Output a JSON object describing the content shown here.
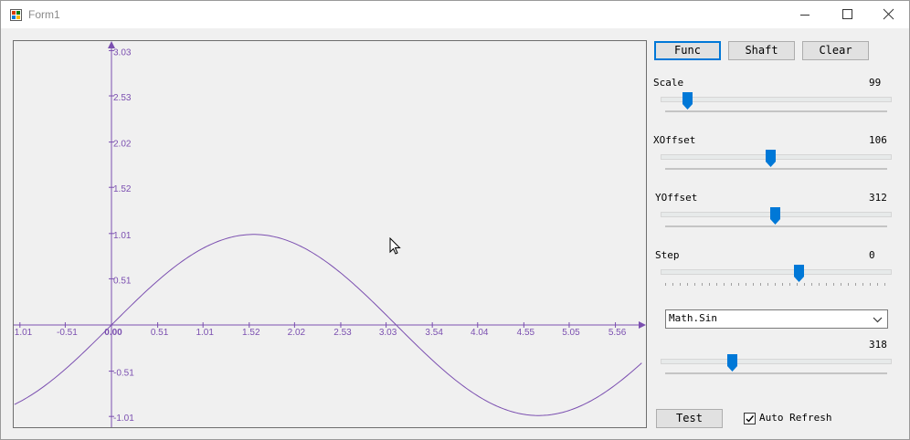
{
  "window": {
    "title": "Form1",
    "icon": "form-app-icon",
    "controls": [
      "minimize-icon",
      "maximize-icon",
      "close-icon"
    ]
  },
  "toolbar": {
    "func_label": "Func",
    "shaft_label": "Shaft",
    "clear_label": "Clear"
  },
  "sliders": {
    "scale": {
      "label": "Scale",
      "value": "99",
      "level": 0.1
    },
    "xoffset": {
      "label": "XOffset",
      "value": "106",
      "level": 0.49
    },
    "yoffset": {
      "label": "YOffset",
      "value": "312",
      "level": 0.51
    },
    "step": {
      "label": "Step",
      "value": "0",
      "level": 0.62
    },
    "function_param": {
      "value": "318",
      "level": 0.31
    }
  },
  "function_select": {
    "selected": "Math.Sin"
  },
  "bottom": {
    "test_label": "Test",
    "auto_refresh_label": "Auto Refresh",
    "auto_refresh_checked": true
  },
  "chart_data": {
    "type": "line",
    "function": "Math.Sin",
    "x_ticks": [
      "-1.01",
      "-0.51",
      "0.00",
      "0.51",
      "1.01",
      "1.52",
      "2.02",
      "2.53",
      "3.03",
      "3.54",
      "4.04",
      "4.55",
      "5.05",
      "5.56"
    ],
    "y_ticks": [
      "3.03",
      "2.53",
      "2.02",
      "1.52",
      "1.01",
      "0.51",
      "-0.51",
      "-1.01"
    ],
    "xlim": [
      -1.07,
      5.85
    ],
    "ylim": [
      -1.07,
      3.2
    ],
    "series": [
      {
        "x": [
          -1.07,
          -0.75,
          -0.5,
          -0.25,
          0,
          0.25,
          0.5,
          0.75,
          1.0,
          1.25,
          1.5707,
          1.75,
          2.0,
          2.25,
          2.5,
          2.75,
          3.0,
          3.1416,
          3.5,
          4.0,
          4.5,
          4.7124,
          5.0,
          5.5,
          5.85
        ],
        "y": [
          -0.877,
          -0.682,
          -0.479,
          -0.247,
          0.0,
          0.247,
          0.479,
          0.682,
          0.841,
          0.949,
          1.0,
          0.984,
          0.909,
          0.778,
          0.598,
          0.382,
          0.141,
          0.0,
          -0.351,
          -0.757,
          -0.978,
          -1.0,
          -0.959,
          -0.706,
          -0.417
        ]
      }
    ],
    "color": "#7b4fb0",
    "grid": false
  },
  "colors": {
    "axis": "#7b4fb0",
    "accent": "#0078d7",
    "window_bg": "#f0f0f0"
  },
  "cursor": "mouse-pointer-icon"
}
